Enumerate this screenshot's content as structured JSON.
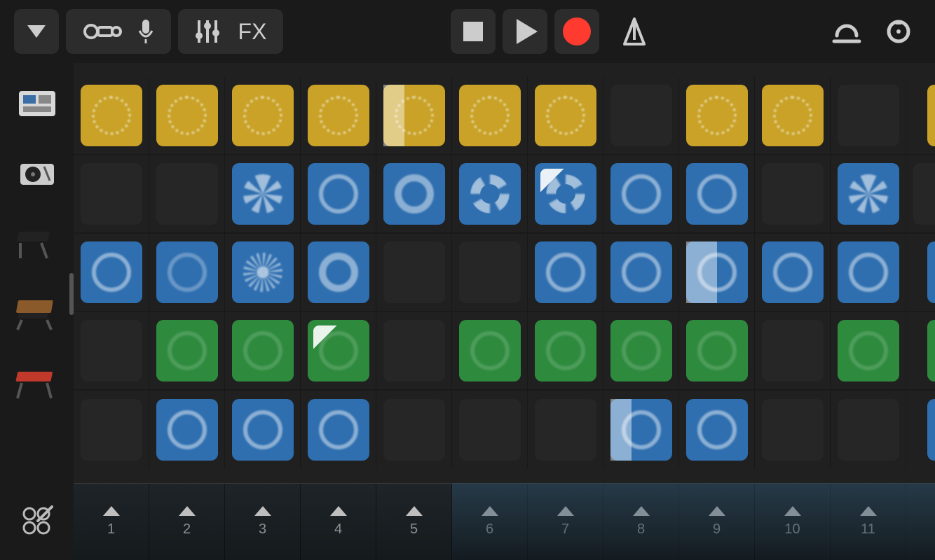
{
  "toolbar": {
    "fx_label": "FX"
  },
  "colors": {
    "yellow": "#c9a227",
    "blue": "#2f6fb0",
    "green": "#2e8b3e",
    "record": "#ff3b2f"
  },
  "tracks": [
    {
      "instrument": "drum-machine"
    },
    {
      "instrument": "turntable"
    },
    {
      "instrument": "synth-keys"
    },
    {
      "instrument": "moog-synth"
    },
    {
      "instrument": "keyboard-red"
    }
  ],
  "scenes": [
    "1",
    "2",
    "3",
    "4",
    "5",
    "6",
    "7",
    "8",
    "9",
    "10",
    "11"
  ],
  "grid": [
    [
      {
        "c": "yellow",
        "v": "sun"
      },
      {
        "c": "yellow",
        "v": "sun"
      },
      {
        "c": "yellow",
        "v": "sun"
      },
      {
        "c": "yellow",
        "v": "sun"
      },
      {
        "c": "yellow",
        "v": "sun",
        "play": 0.35
      },
      {
        "c": "yellow",
        "v": "sun"
      },
      {
        "c": "yellow",
        "v": "sun"
      },
      null,
      {
        "c": "yellow",
        "v": "sun"
      },
      {
        "c": "yellow",
        "v": "sun"
      },
      null,
      {
        "c": "yellow",
        "v": "sun",
        "edge": true
      }
    ],
    [
      null,
      null,
      {
        "c": "blue",
        "v": "flower"
      },
      {
        "c": "blue",
        "v": "ring"
      },
      {
        "c": "blue",
        "v": "ringwide"
      },
      {
        "c": "blue",
        "v": "quad"
      },
      {
        "c": "blue",
        "v": "quad",
        "wedge": true
      },
      {
        "c": "blue",
        "v": "ring"
      },
      {
        "c": "blue",
        "v": "ring"
      },
      null,
      {
        "c": "blue",
        "v": "flower"
      },
      null
    ],
    [
      {
        "c": "blue",
        "v": "ring"
      },
      {
        "c": "blue",
        "v": "soft"
      },
      {
        "c": "blue",
        "v": "burst"
      },
      {
        "c": "blue",
        "v": "ringwide"
      },
      null,
      null,
      {
        "c": "blue",
        "v": "ring"
      },
      {
        "c": "blue",
        "v": "ring"
      },
      {
        "c": "blue",
        "v": "ring",
        "play": 0.5
      },
      {
        "c": "blue",
        "v": "ring"
      },
      {
        "c": "blue",
        "v": "ring"
      },
      {
        "c": "blue",
        "v": "soft",
        "edge": true
      }
    ],
    [
      null,
      {
        "c": "green",
        "v": "faint"
      },
      {
        "c": "green",
        "v": "faint"
      },
      {
        "c": "green",
        "v": "faint",
        "wedge": true
      },
      null,
      {
        "c": "green",
        "v": "faint"
      },
      {
        "c": "green",
        "v": "faint"
      },
      {
        "c": "green",
        "v": "faint"
      },
      {
        "c": "green",
        "v": "faint"
      },
      null,
      {
        "c": "green",
        "v": "faint"
      },
      {
        "c": "green",
        "v": "faint",
        "edge": true
      }
    ],
    [
      null,
      {
        "c": "blue",
        "v": "ring"
      },
      {
        "c": "blue",
        "v": "ring"
      },
      {
        "c": "blue",
        "v": "ring"
      },
      null,
      null,
      null,
      {
        "c": "blue",
        "v": "ring",
        "play": 0.35
      },
      {
        "c": "blue",
        "v": "ring"
      },
      null,
      null,
      {
        "c": "blue",
        "v": "ring",
        "edge": true
      }
    ]
  ]
}
